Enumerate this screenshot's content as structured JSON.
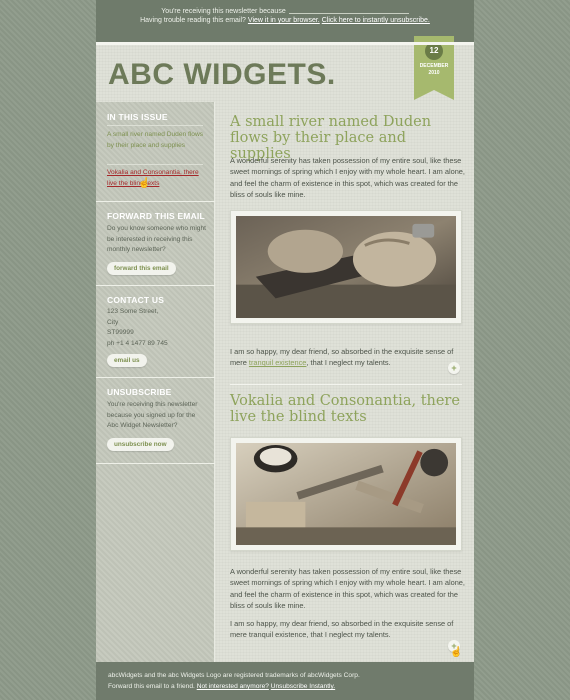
{
  "preheader": {
    "line1": "You're receiving this newsletter because",
    "line2_prefix": "Having trouble reading this email?",
    "view_in_browser": "View it in your browser.",
    "unsubscribe_link": "Click here to instantly unsubscribe."
  },
  "header": {
    "logo": "ABC WIDGETS.",
    "date_day": "12",
    "date_month": "DECEMBER",
    "date_year": "2010"
  },
  "sidebar": {
    "in_this_issue": {
      "heading": "IN THIS ISSUE",
      "item1": "A small river named Duden flows by their place and supplies",
      "item2": "Vokalia and Consonantia, there live the blind texts"
    },
    "forward": {
      "heading": "FORWARD THIS EMAIL",
      "text": "Do you know someone who might be interested in receiving this monthly newsletter?",
      "button": "forward this email"
    },
    "contact": {
      "heading": "CONTACT US",
      "address1": "123 Some Street,",
      "address2": "City",
      "address3": "ST99999",
      "phone": "ph +1 4 1477 89 745",
      "button": "email us"
    },
    "unsubscribe": {
      "heading": "UNSUBSCRIBE",
      "text": "You're receiving this newsletter because you signed up for the Abc Widget Newsletter?",
      "button": "unsubscribe now"
    }
  },
  "articles": [
    {
      "title": "A small river named Duden flows by their place and supplies",
      "para1": "A wonderful serenity has taken possession of my entire soul, like these sweet mornings of spring which I enjoy with my whole heart. I am alone, and feel the charm of existence in this spot, which was created for the bliss of souls like mine.",
      "para2_before": "I am so happy, my dear friend, so absorbed in the exquisite sense of mere",
      "para2_link": "tranquil existence",
      "para2_after": ", that I neglect my talents.",
      "image": "woodworking-plane-photo"
    },
    {
      "title": "Vokalia and Consonantia, there live the blind texts",
      "para1": "A wonderful serenity has taken possession of my entire soul, like these sweet mornings of spring which I enjoy with my whole heart. I am alone, and feel the charm of existence in this spot, which was created for the bliss of souls like mine.",
      "para2": "I am so happy, my dear friend, so absorbed in the exquisite sense of mere tranquil existence, that I neglect my talents.",
      "image": "workbench-tools-photo"
    }
  ],
  "plus_glyph": "+",
  "footer": {
    "line1": "abcWidgets and the abc Widgets Logo are registered trademarks of abcWidgets Corp.",
    "line2_prefix": "Forward this email to a friend.",
    "not_interested": "Not interested anymore?",
    "unsubscribe": "Unsubscribe Instantly."
  },
  "colors": {
    "background": "#8e9a8a",
    "accent_green": "#8ea35c",
    "link_red": "#a5282a",
    "ribbon": "#a6b96e"
  }
}
